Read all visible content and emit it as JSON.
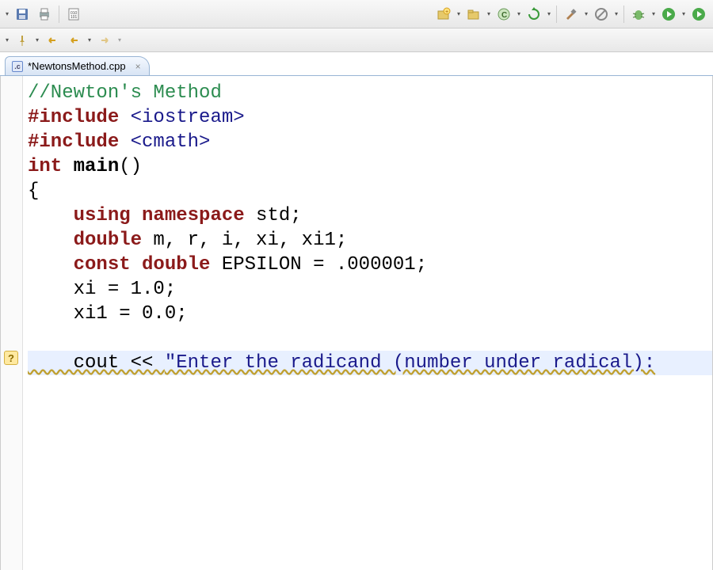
{
  "toolbar_top": {
    "new_dd": "▾",
    "save": "save",
    "print": "print",
    "binary": "binary"
  },
  "toolbar_right": {
    "r1": "new-project",
    "r2": "new-folder",
    "r3": "new-class",
    "r4": "refresh",
    "r5": "build",
    "r6": "skip",
    "r7": "debug",
    "r8": "run",
    "r9": "run-last"
  },
  "toolbar_2": {
    "b1": "toggle",
    "b2": "pin",
    "b3": "back-to",
    "b4": "back",
    "b5": "forward"
  },
  "tab": {
    "icon_letter": ".c",
    "title": "*NewtonsMethod.cpp",
    "close": "×"
  },
  "code": {
    "l1_comment": "//Newton's Method",
    "l2_pre": "#include",
    "l2_inc": "<iostream>",
    "l3_pre": "#include",
    "l3_inc": "<cmath>",
    "l4_kw": "int",
    "l4_fn": "main",
    "l4_rest": "()",
    "l5": "{",
    "l6_k1": "using",
    "l6_k2": "namespace",
    "l6_rest": " std;",
    "l7_kw": "double",
    "l7_rest": " m, r, i, xi, xi1;",
    "l8_k1": "const",
    "l8_k2": "double",
    "l8_rest": " EPSILON = .000001;",
    "l9": "    xi = 1.0;",
    "l10": "    xi1 = 0.0;",
    "l11": "",
    "l12_pre": "    cout << ",
    "l12_str": "\"Enter the radicand (number under radical):"
  },
  "gutter": {
    "marker": "?"
  }
}
